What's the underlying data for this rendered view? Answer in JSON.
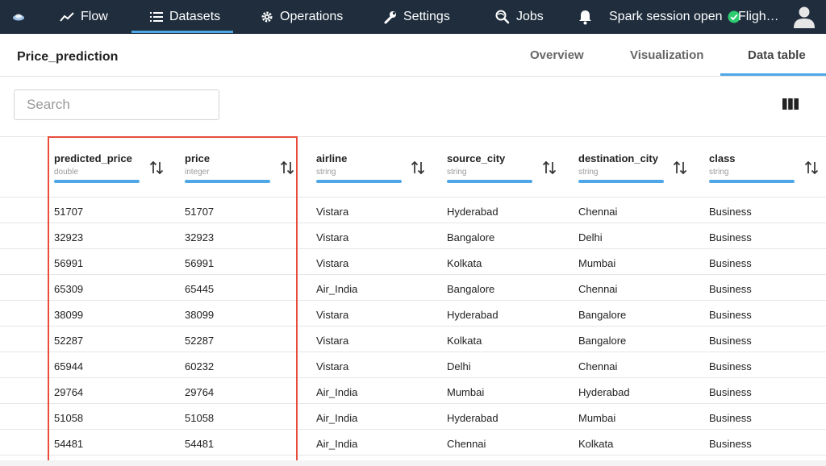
{
  "topnav": {
    "items": [
      {
        "label": "Flow",
        "icon": "trend-icon"
      },
      {
        "label": "Datasets",
        "icon": "list-icon"
      },
      {
        "label": "Operations",
        "icon": "gear-icon"
      },
      {
        "label": "Settings",
        "icon": "wrench-icon"
      },
      {
        "label": "Jobs",
        "icon": "search-globe-icon"
      }
    ],
    "active": "Datasets",
    "session_status": "Spark session open",
    "project": "Fligh…"
  },
  "page": {
    "title": "Price_prediction",
    "tabs": [
      {
        "label": "Overview"
      },
      {
        "label": "Visualization"
      },
      {
        "label": "Data table"
      }
    ],
    "active_tab": "Data table"
  },
  "search": {
    "placeholder": "Search",
    "value": ""
  },
  "table": {
    "columns": [
      {
        "name": "predicted_price",
        "type": "double"
      },
      {
        "name": "price",
        "type": "integer"
      },
      {
        "name": "airline",
        "type": "string"
      },
      {
        "name": "source_city",
        "type": "string"
      },
      {
        "name": "destination_city",
        "type": "string"
      },
      {
        "name": "class",
        "type": "string"
      }
    ],
    "rows": [
      [
        "51707",
        "51707",
        "Vistara",
        "Hyderabad",
        "Chennai",
        "Business"
      ],
      [
        "32923",
        "32923",
        "Vistara",
        "Bangalore",
        "Delhi",
        "Business"
      ],
      [
        "56991",
        "56991",
        "Vistara",
        "Kolkata",
        "Mumbai",
        "Business"
      ],
      [
        "65309",
        "65445",
        "Air_India",
        "Bangalore",
        "Chennai",
        "Business"
      ],
      [
        "38099",
        "38099",
        "Vistara",
        "Hyderabad",
        "Bangalore",
        "Business"
      ],
      [
        "52287",
        "52287",
        "Vistara",
        "Kolkata",
        "Bangalore",
        "Business"
      ],
      [
        "65944",
        "60232",
        "Vistara",
        "Delhi",
        "Chennai",
        "Business"
      ],
      [
        "29764",
        "29764",
        "Air_India",
        "Mumbai",
        "Hyderabad",
        "Business"
      ],
      [
        "51058",
        "51058",
        "Air_India",
        "Hyderabad",
        "Mumbai",
        "Business"
      ],
      [
        "54481",
        "54481",
        "Air_India",
        "Chennai",
        "Kolkata",
        "Business"
      ]
    ]
  },
  "colors": {
    "topbar": "#1f2d3d",
    "accent": "#4ea7e6",
    "highlight": "#e84c3d",
    "status_ok": "#2ecc71"
  }
}
